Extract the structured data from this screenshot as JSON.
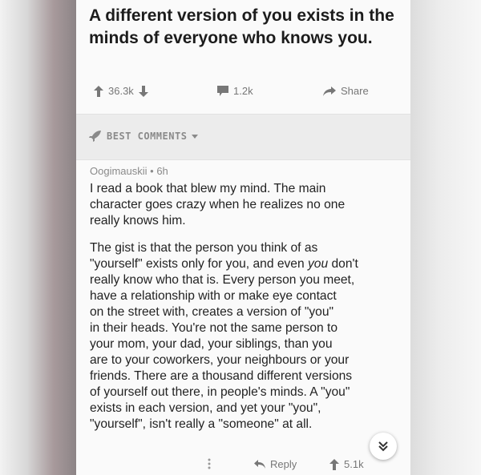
{
  "post": {
    "title": "A different version of you exists in the minds of everyone who knows you.",
    "upvotes": "36.3k",
    "comments": "1.2k",
    "share_label": "Share"
  },
  "sort": {
    "label": "BEST COMMENTS"
  },
  "comment": {
    "author": "Oogimauskii",
    "age": "• 6h",
    "para1": "I read a book that blew my mind. The main\ncharacter goes crazy when he realizes no one\nreally knows him.",
    "para2_before": "The gist is that the person you think of as\n\"yourself\" exists only for you, and even ",
    "para2_em": "you",
    "para2_after": " don't\nreally know who that is. Every person you meet,\nhave a relationship with or make eye contact\non the street with, creates a version of \"you\"\nin their heads. You're not the same person to\nyour mom, your dad, your siblings, than you\nare to your coworkers, your neighbours or your\nfriends. There are a thousand different versions\nof yourself out there, in people's minds. A \"you\"\nexists in each version, and yet your \"you\",\n\"yourself\", isn't really a \"someone\" at all.",
    "reply_label": "Reply",
    "upvotes": "5.1k"
  },
  "icons": {
    "upvote": "arrow-up-icon",
    "downvote": "arrow-down-icon",
    "comments": "comment-bubble-icon",
    "share": "share-arrow-icon",
    "sort": "rocket-icon",
    "dropdown": "caret-down-icon",
    "more": "vertical-dots-icon",
    "reply": "reply-arrow-icon",
    "scroll": "double-chevron-down-icon"
  },
  "colors": {
    "text": "#222222",
    "muted": "#8a8a8a",
    "sort_bar": "#ececec"
  }
}
